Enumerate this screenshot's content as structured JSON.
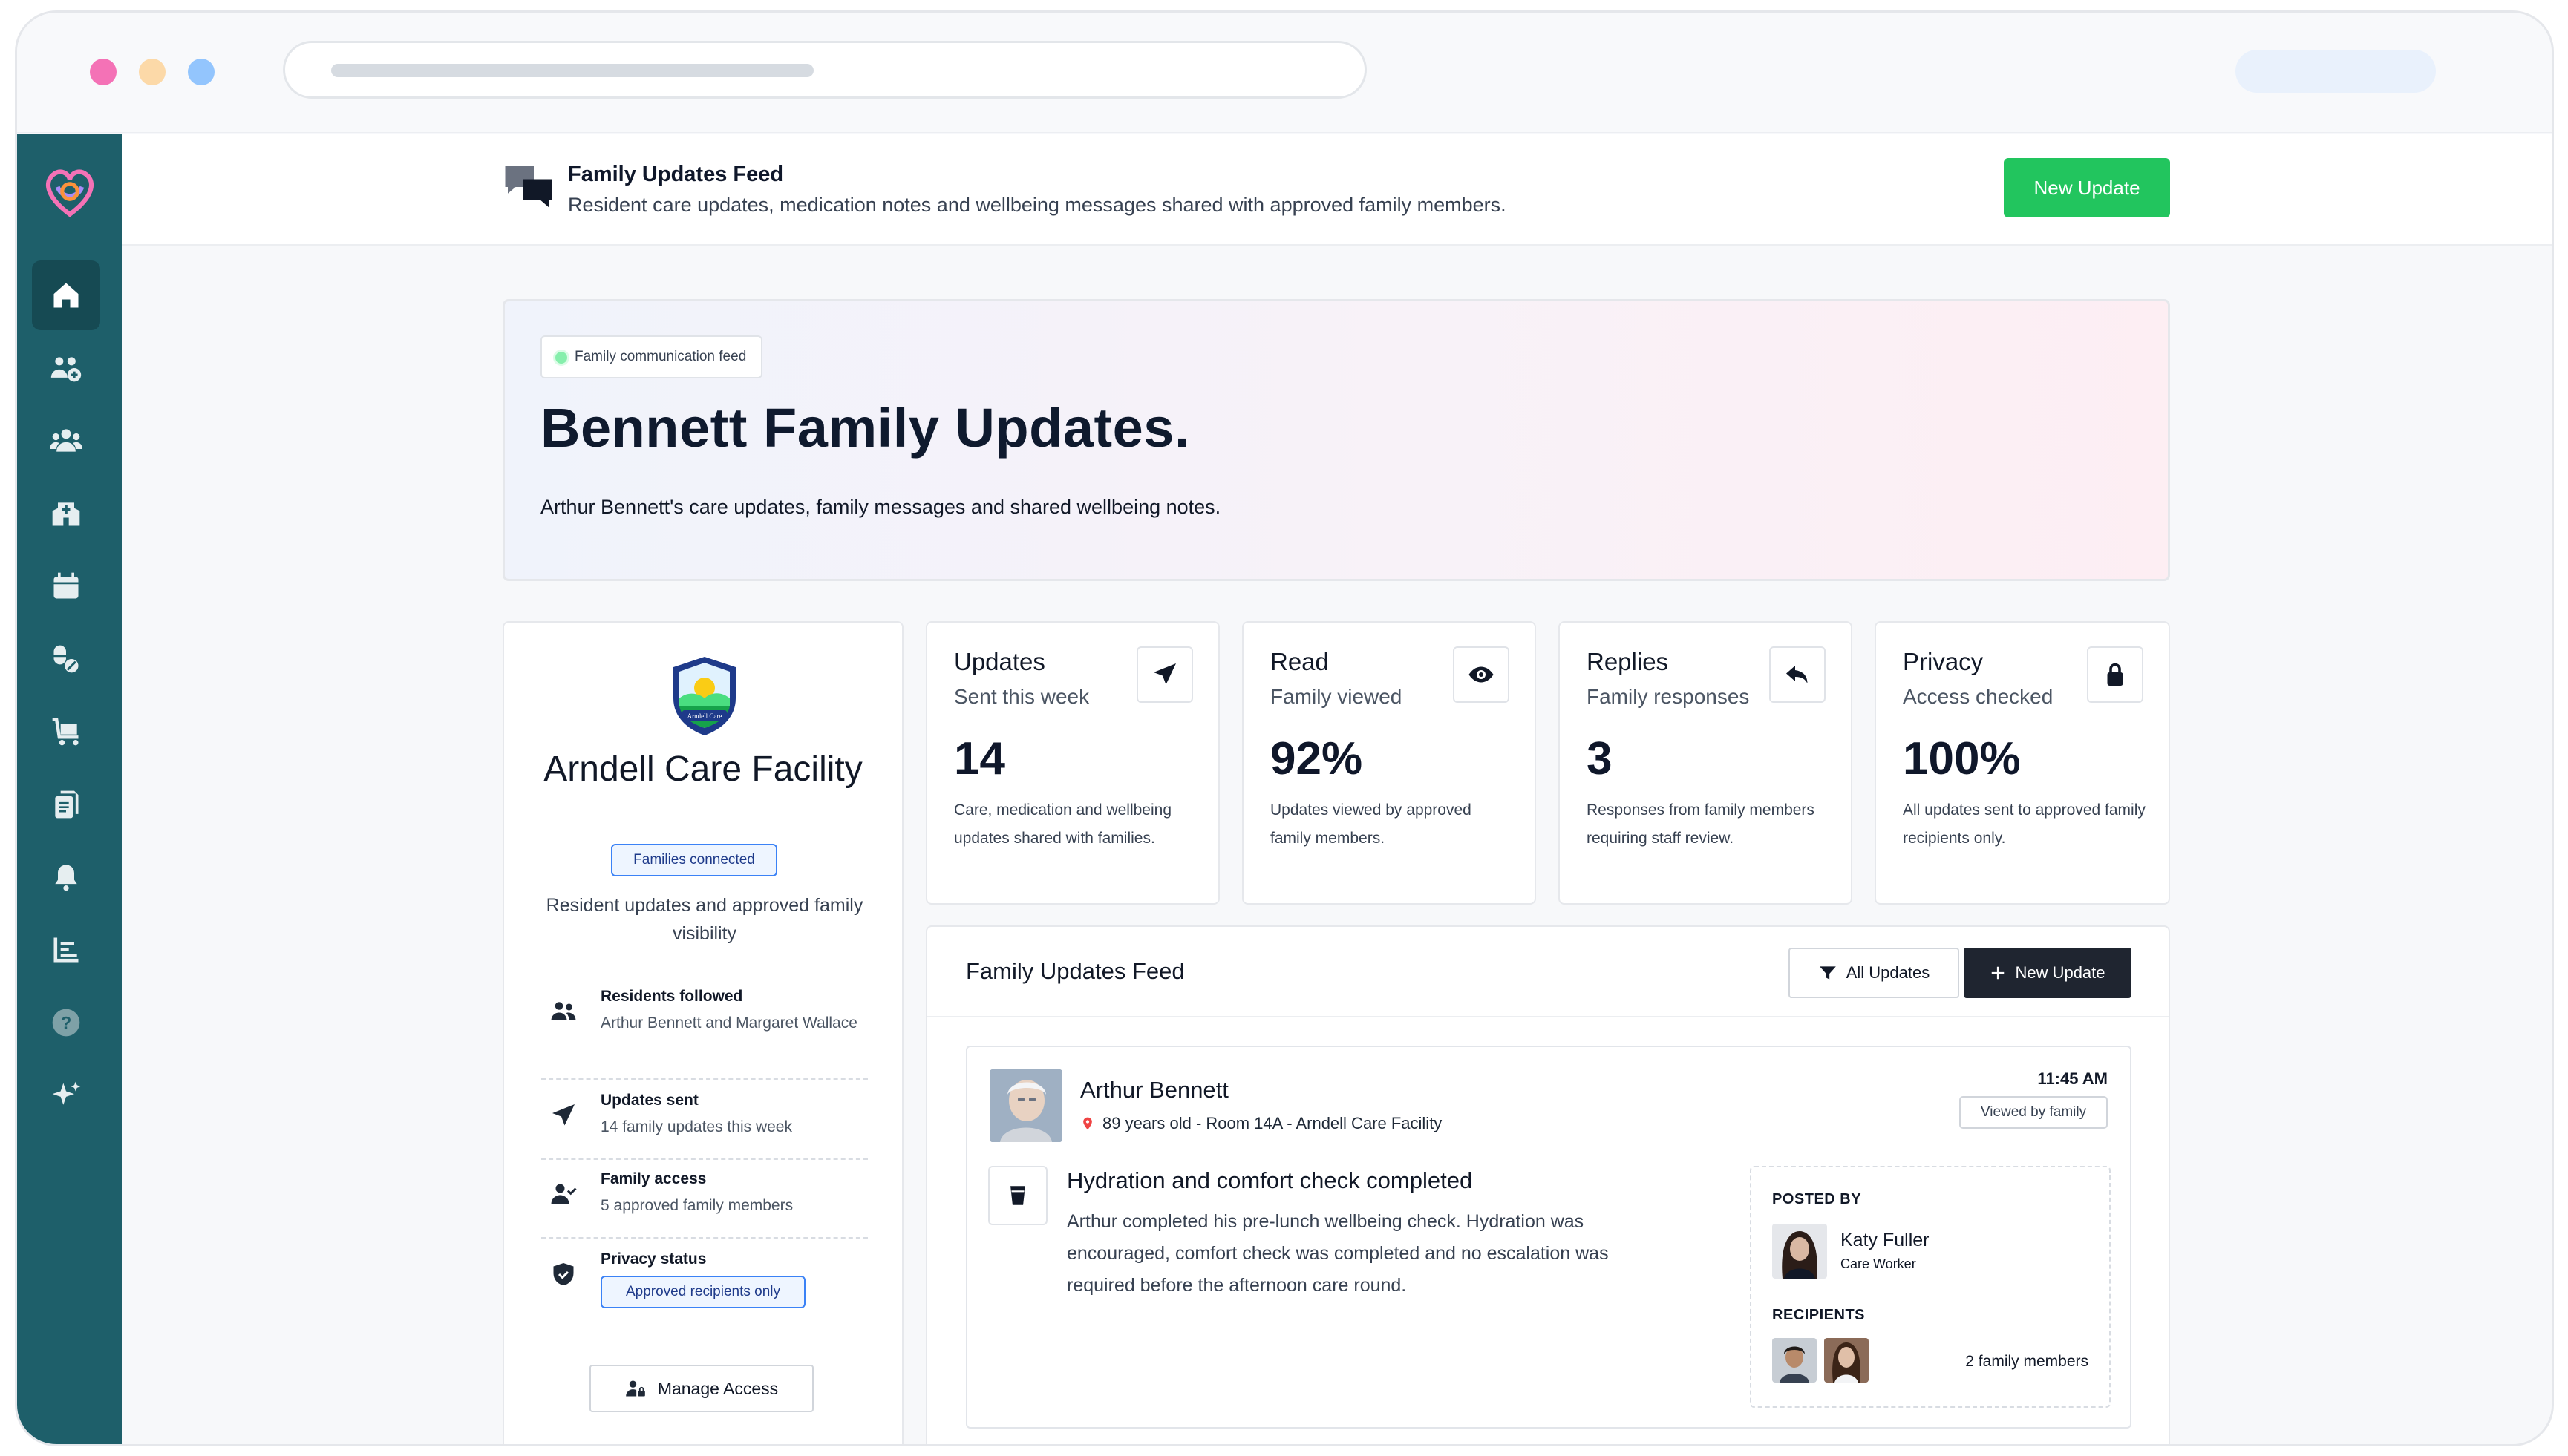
{
  "browser": {
    "url_placeholder": ""
  },
  "topbar": {
    "title": "Family Updates Feed",
    "subtitle": "Resident care updates, medication notes and wellbeing messages shared with approved family members.",
    "new_update_label": "New Update"
  },
  "sidebar": {
    "items": [
      {
        "icon": "home-icon",
        "active": true
      },
      {
        "icon": "residents-add-icon"
      },
      {
        "icon": "family-group-icon"
      },
      {
        "icon": "facility-icon"
      },
      {
        "icon": "calendar-icon"
      },
      {
        "icon": "medication-icon"
      },
      {
        "icon": "trolley-icon"
      },
      {
        "icon": "documents-icon"
      },
      {
        "icon": "bell-icon"
      },
      {
        "icon": "reports-icon"
      },
      {
        "icon": "help-icon"
      },
      {
        "icon": "sparkle-icon"
      }
    ]
  },
  "hero": {
    "badge": "Family communication feed",
    "title": "Bennett Family Updates.",
    "subtitle": "Arthur Bennett's care updates, family messages and shared wellbeing notes."
  },
  "facility": {
    "crest_text": "Arndell Care",
    "name": "Arndell Care Facility",
    "pill": "Families connected",
    "description": "Resident updates and approved family visibility",
    "rows": [
      {
        "title": "Residents followed",
        "sub": "Arthur Bennett and Margaret Wallace"
      },
      {
        "title": "Updates sent",
        "sub": "14 family updates this week"
      },
      {
        "title": "Family access",
        "sub": "5 approved family members"
      },
      {
        "title": "Privacy status",
        "pill": "Approved recipients only"
      }
    ],
    "manage_label": "Manage Access"
  },
  "stats": [
    {
      "label": "Updates",
      "sub": "Sent this week",
      "value": "14",
      "desc": "Care, medication and wellbeing updates shared with families.",
      "icon": "send-icon"
    },
    {
      "label": "Read",
      "sub": "Family viewed",
      "value": "92%",
      "desc": "Updates viewed by approved family members.",
      "icon": "eye-icon"
    },
    {
      "label": "Replies",
      "sub": "Family responses",
      "value": "3",
      "desc": "Responses from family members requiring staff review.",
      "icon": "reply-icon"
    },
    {
      "label": "Privacy",
      "sub": "Access checked",
      "value": "100%",
      "desc": "All updates sent to approved family recipients only.",
      "icon": "lock-icon"
    }
  ],
  "feed": {
    "title": "Family Updates Feed",
    "filter_label": "All Updates",
    "new_label": "New Update",
    "post": {
      "name": "Arthur Bennett",
      "meta": "89 years old - Room 14A - Arndell Care Facility",
      "time": "11:45 AM",
      "viewed": "Viewed by family",
      "title": "Hydration and comfort check completed",
      "body": "Arthur completed his pre-lunch wellbeing check. Hydration was encouraged, comfort check was completed and no escalation was required before the afternoon care round.",
      "posted_by_label": "POSTED BY",
      "poster_name": "Katy Fuller",
      "poster_role": "Care Worker",
      "recipients_label": "RECIPIENTS",
      "recipients_count": "2 family members"
    }
  },
  "colors": {
    "sidebar": "#1e5f6a",
    "accent_green": "#22c55e",
    "dark_button": "#1f2530"
  }
}
